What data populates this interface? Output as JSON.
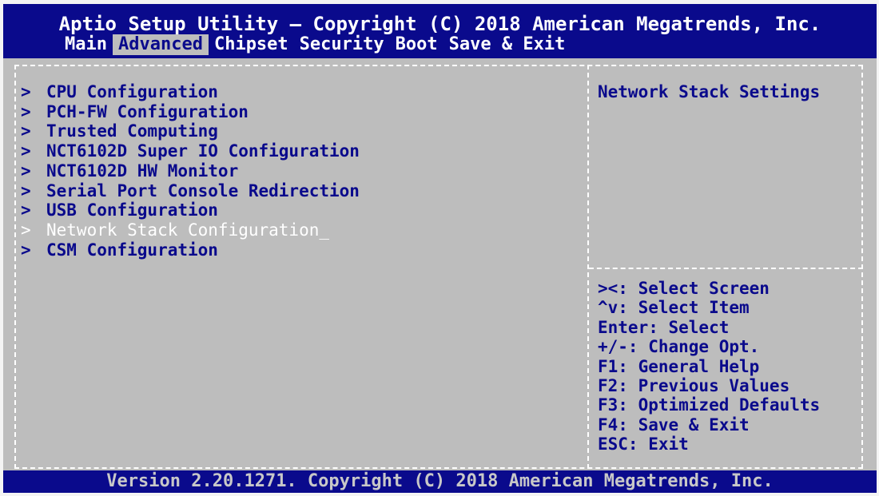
{
  "header": {
    "title": "Aptio Setup Utility – Copyright (C) 2018 American Megatrends, Inc.",
    "tabs": [
      {
        "label": "Main",
        "active": false
      },
      {
        "label": "Advanced",
        "active": true
      },
      {
        "label": "Chipset",
        "active": false
      },
      {
        "label": "Security",
        "active": false
      },
      {
        "label": "Boot",
        "active": false
      },
      {
        "label": "Save & Exit",
        "active": false
      }
    ]
  },
  "menu": {
    "arrow": ">",
    "items": [
      {
        "label": "CPU Configuration"
      },
      {
        "label": "PCH-FW Configuration"
      },
      {
        "label": "Trusted Computing"
      },
      {
        "label": "NCT6102D Super IO Configuration"
      },
      {
        "label": "NCT6102D HW Monitor"
      },
      {
        "label": "Serial Port Console Redirection"
      },
      {
        "label": "USB Configuration"
      },
      {
        "label": "Network Stack Configuration",
        "selected": true
      },
      {
        "label": "CSM Configuration"
      }
    ],
    "cursor": "_"
  },
  "help": {
    "text": "Network Stack Settings"
  },
  "keys": [
    "><: Select Screen",
    "^v: Select Item",
    "Enter: Select",
    "+/-: Change Opt.",
    "F1: General Help",
    "F2: Previous Values",
    "F3: Optimized Defaults",
    "F4: Save & Exit",
    "ESC: Exit"
  ],
  "footer": {
    "version": "Version 2.20.1271. Copyright (C) 2018 American Megatrends, Inc."
  },
  "colors": {
    "header_bg": "#0a0a8c",
    "body_bg": "#bdbdbd",
    "text": "#0a0a8c",
    "highlight_text": "#ffffff"
  }
}
